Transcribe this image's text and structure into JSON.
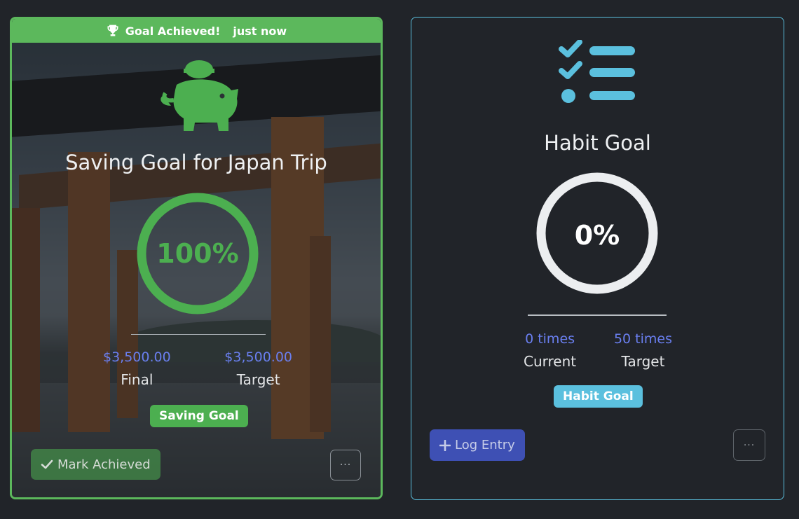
{
  "cards": [
    {
      "banner": {
        "icon": "trophy-icon",
        "text": "Goal Achieved!",
        "time": "just now"
      },
      "icon": "piggy-bank-icon",
      "title": "Saving Goal for Japan Trip",
      "progress": {
        "percent": 100,
        "label": "100%"
      },
      "values": [
        {
          "value": "$3,500.00",
          "label": "Final"
        },
        {
          "value": "$3,500.00",
          "label": "Target"
        }
      ],
      "badge": "Saving Goal",
      "primary_button": {
        "icon": "check-icon",
        "label": "Mark Achieved"
      },
      "more_button": {
        "icon": "more-icon",
        "label": "···"
      },
      "colors": {
        "accent": "#4caf50",
        "border": "#5cb85c",
        "value": "#6a7ff0"
      }
    },
    {
      "icon": "checklist-icon",
      "title": "Habit Goal",
      "progress": {
        "percent": 0,
        "label": "0%"
      },
      "values": [
        {
          "value": "0 times",
          "label": "Current"
        },
        {
          "value": "50 times",
          "label": "Target"
        }
      ],
      "badge": "Habit Goal",
      "primary_button": {
        "icon": "plus-icon",
        "label": "Log Entry"
      },
      "more_button": {
        "icon": "more-icon",
        "label": "···"
      },
      "colors": {
        "accent": "#5bc0de",
        "border": "#5bc0de",
        "button": "#3e50b4"
      }
    }
  ]
}
